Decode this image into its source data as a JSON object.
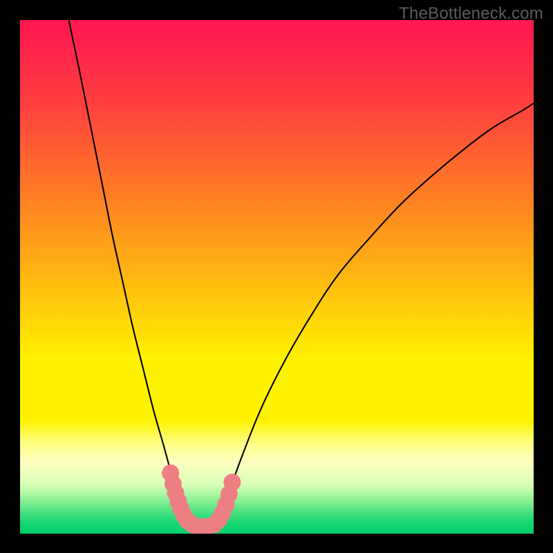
{
  "watermark": "TheBottleneck.com",
  "chart_data": {
    "type": "line",
    "title": "",
    "xlabel": "",
    "ylabel": "",
    "xlim": [
      0,
      1
    ],
    "ylim": [
      0,
      1
    ],
    "series": [
      {
        "name": "left-curve",
        "x": [
          0.095,
          0.12,
          0.14,
          0.16,
          0.18,
          0.2,
          0.22,
          0.24,
          0.26,
          0.28,
          0.298,
          0.315,
          0.33
        ],
        "y": [
          1.0,
          0.88,
          0.78,
          0.68,
          0.58,
          0.49,
          0.4,
          0.32,
          0.24,
          0.17,
          0.105,
          0.055,
          0.018
        ]
      },
      {
        "name": "right-curve",
        "x": [
          0.385,
          0.405,
          0.43,
          0.47,
          0.52,
          0.57,
          0.62,
          0.68,
          0.74,
          0.8,
          0.86,
          0.92,
          0.98,
          1.0
        ],
        "y": [
          0.018,
          0.075,
          0.145,
          0.245,
          0.345,
          0.43,
          0.505,
          0.575,
          0.64,
          0.695,
          0.745,
          0.79,
          0.825,
          0.838
        ]
      }
    ],
    "markers": {
      "name": "highlight-band",
      "color": "#ed7f83",
      "points": [
        {
          "x": 0.293,
          "y": 0.118
        },
        {
          "x": 0.298,
          "y": 0.097
        },
        {
          "x": 0.303,
          "y": 0.079
        },
        {
          "x": 0.308,
          "y": 0.063
        },
        {
          "x": 0.313,
          "y": 0.049
        },
        {
          "x": 0.319,
          "y": 0.036
        },
        {
          "x": 0.326,
          "y": 0.025
        },
        {
          "x": 0.335,
          "y": 0.018
        },
        {
          "x": 0.345,
          "y": 0.014
        },
        {
          "x": 0.356,
          "y": 0.013
        },
        {
          "x": 0.367,
          "y": 0.014
        },
        {
          "x": 0.378,
          "y": 0.018
        },
        {
          "x": 0.387,
          "y": 0.027
        },
        {
          "x": 0.394,
          "y": 0.04
        },
        {
          "x": 0.401,
          "y": 0.057
        },
        {
          "x": 0.407,
          "y": 0.077
        },
        {
          "x": 0.413,
          "y": 0.1
        }
      ]
    },
    "gradient": {
      "stops": [
        {
          "pos": 0.0,
          "color": "#ff1752"
        },
        {
          "pos": 0.16,
          "color": "#ff3f3f"
        },
        {
          "pos": 0.33,
          "color": "#ff7a26"
        },
        {
          "pos": 0.5,
          "color": "#ffb811"
        },
        {
          "pos": 0.66,
          "color": "#fff200"
        },
        {
          "pos": 0.78,
          "color": "#fff200"
        },
        {
          "pos": 0.82,
          "color": "#ffff7a"
        },
        {
          "pos": 0.86,
          "color": "#ffffc2"
        },
        {
          "pos": 0.905,
          "color": "#d8ffb6"
        },
        {
          "pos": 0.924,
          "color": "#a8f7a0"
        },
        {
          "pos": 0.944,
          "color": "#72eb8c"
        },
        {
          "pos": 0.962,
          "color": "#41df7e"
        },
        {
          "pos": 0.98,
          "color": "#18d573"
        },
        {
          "pos": 1.0,
          "color": "#01cf6d"
        }
      ]
    }
  }
}
